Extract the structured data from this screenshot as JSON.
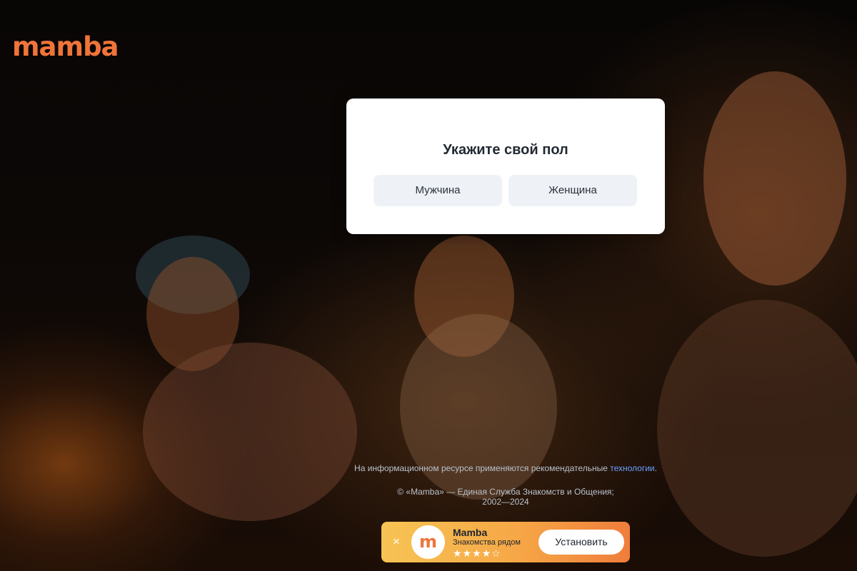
{
  "brand": {
    "logo_text": "mamba",
    "accent_color": "#f0743a"
  },
  "modal": {
    "title": "Укажите свой пол",
    "options": [
      {
        "label": "Мужчина"
      },
      {
        "label": "Женщина"
      }
    ]
  },
  "footer": {
    "notice_prefix": "На информационном ресурсе применяются рекомендательные",
    "notice_link": "технологии",
    "notice_suffix": ".",
    "copyright_line1": "© «Mamba» — Единая Служба Знакомств и Общения;",
    "copyright_line2": "2002—2024"
  },
  "app_banner": {
    "close_icon": "×",
    "app_icon_letter": "m",
    "app_name": "Mamba",
    "subtitle": "Знакомства рядом",
    "rating": 4.5,
    "stars_display": "★★★★☆",
    "install_label": "Установить"
  }
}
